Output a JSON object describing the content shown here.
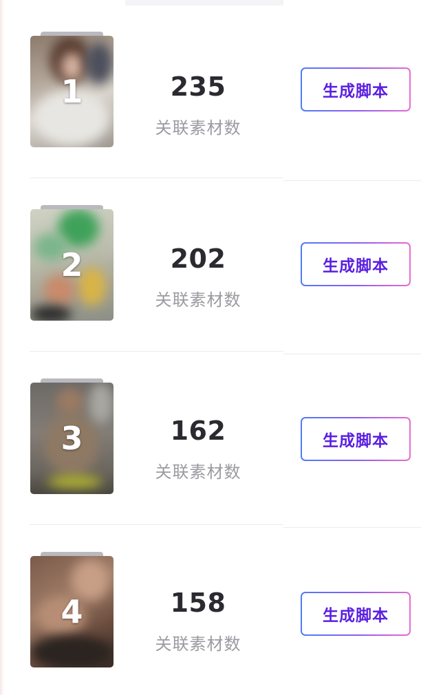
{
  "metric_label": "关联素材数",
  "button_label": "生成脚本",
  "items": [
    {
      "rank": "1",
      "count": "235",
      "thumbnail": "blurred-woman-photo"
    },
    {
      "rank": "2",
      "count": "202",
      "thumbnail": "blurred-green-yellow-photo"
    },
    {
      "rank": "3",
      "count": "162",
      "thumbnail": "blurred-man-photo"
    },
    {
      "rank": "4",
      "count": "158",
      "thumbnail": "blurred-closeup-photo"
    }
  ]
}
